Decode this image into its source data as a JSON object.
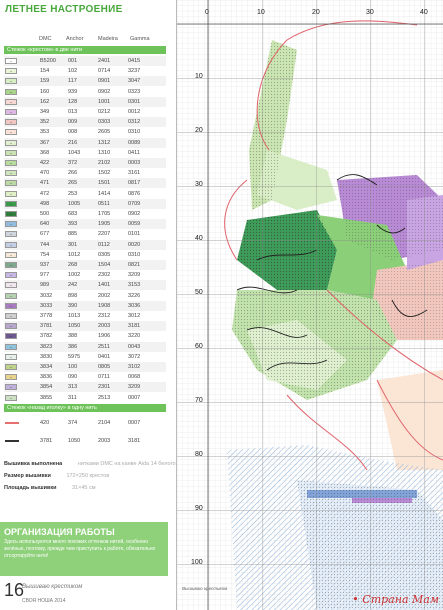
{
  "page": {
    "title": "ЛЕТНЕЕ НАСТРОЕНИЕ",
    "number": "16",
    "magazine": "Вышиваю крестиком",
    "issue": "СВОЯ НОША 2014"
  },
  "legend": {
    "columns": [
      "DMC",
      "Anchor",
      "Madeira",
      "Gamma"
    ],
    "section_cross": "Стежок «крестом» в две нити",
    "rows": [
      {
        "sym": "··",
        "c": "#ffffff",
        "v": [
          "B5200",
          "001",
          "2401",
          "0415"
        ]
      },
      {
        "sym": "··",
        "c": "#e9f4d8",
        "v": [
          "154",
          "102",
          "0714",
          "3237"
        ]
      },
      {
        "sym": "··",
        "c": "#d7eec3",
        "v": [
          "159",
          "117",
          "0901",
          "3047"
        ]
      },
      {
        "sym": "··",
        "c": "#a9d48a",
        "v": [
          "160",
          "939",
          "0902",
          "0323"
        ]
      },
      {
        "sym": "··",
        "c": "#f7d8d4",
        "v": [
          "162",
          "128",
          "1001",
          "0301"
        ]
      },
      {
        "sym": "··",
        "c": "#dfb8e6",
        "v": [
          "349",
          "013",
          "0212",
          "0012"
        ]
      },
      {
        "sym": "··",
        "c": "#f2c6c2",
        "v": [
          "352",
          "009",
          "0303",
          "0312"
        ]
      },
      {
        "sym": "··",
        "c": "#fbe2d8",
        "v": [
          "353",
          "008",
          "2605",
          "0310"
        ]
      },
      {
        "sym": "··",
        "c": "#e2efd1",
        "v": [
          "367",
          "216",
          "1312",
          "0089"
        ]
      },
      {
        "sym": "··",
        "c": "#c9e4b2",
        "v": [
          "368",
          "1043",
          "1310",
          "0411"
        ]
      },
      {
        "sym": "··",
        "c": "#b8dc9c",
        "v": [
          "422",
          "372",
          "2102",
          "0003"
        ]
      },
      {
        "sym": "··",
        "c": "#cfe5bb",
        "v": [
          "470",
          "266",
          "1502",
          "3161"
        ]
      },
      {
        "sym": "··",
        "c": "#bcdba4",
        "v": [
          "471",
          "265",
          "1501",
          "0817"
        ]
      },
      {
        "sym": "··",
        "c": "#e2f0c8",
        "v": [
          "472",
          "253",
          "1414",
          "0876"
        ]
      },
      {
        "sym": "··",
        "c": "#3a9c4a",
        "v": [
          "498",
          "1005",
          "0511",
          "0709"
        ]
      },
      {
        "sym": "··",
        "c": "#2f7e3c",
        "v": [
          "500",
          "683",
          "1705",
          "0902"
        ]
      },
      {
        "sym": "··",
        "c": "#93bde0",
        "v": [
          "640",
          "393",
          "1905",
          "0059"
        ]
      },
      {
        "sym": "··",
        "c": "#d0d4dc",
        "v": [
          "677",
          "885",
          "2207",
          "0101"
        ]
      },
      {
        "sym": "··",
        "c": "#c4cfe6",
        "v": [
          "744",
          "301",
          "0112",
          "0020"
        ]
      },
      {
        "sym": "··",
        "c": "#f5e8d6",
        "v": [
          "754",
          "1012",
          "0305",
          "0310"
        ]
      },
      {
        "sym": "··",
        "c": "#7fa98c",
        "v": [
          "937",
          "268",
          "1504",
          "0821"
        ]
      },
      {
        "sym": "··",
        "c": "#c9b8e6",
        "v": [
          "977",
          "1002",
          "2302",
          "3209"
        ]
      },
      {
        "sym": "··",
        "c": "#f2e6ee",
        "v": [
          "989",
          "242",
          "1401",
          "3153"
        ]
      },
      {
        "sym": "··",
        "c": "#b6d1b0",
        "v": [
          "3032",
          "898",
          "2002",
          "3226"
        ]
      },
      {
        "sym": "··",
        "c": "#a97cc2",
        "v": [
          "3033",
          "390",
          "1908",
          "3036"
        ]
      },
      {
        "sym": "··",
        "c": "#cfcfcf",
        "v": [
          "3778",
          "1013",
          "2312",
          "3012"
        ]
      },
      {
        "sym": "··",
        "c": "#b7a7cc",
        "v": [
          "3781",
          "1050",
          "2003",
          "3181"
        ]
      },
      {
        "sym": "··",
        "c": "#6e5790",
        "v": [
          "3782",
          "388",
          "1906",
          "3220"
        ]
      },
      {
        "sym": "··",
        "c": "#8ec5dc",
        "v": [
          "3823",
          "386",
          "2511",
          "0043"
        ]
      },
      {
        "sym": "··",
        "c": "#e6f0ea",
        "v": [
          "3830",
          "5975",
          "0401",
          "3072"
        ]
      },
      {
        "sym": "··",
        "c": "#c0d38a",
        "v": [
          "3834",
          "100",
          "0805",
          "3102"
        ]
      },
      {
        "sym": "··",
        "c": "#ead38c",
        "v": [
          "3836",
          "090",
          "0711",
          "0068"
        ]
      },
      {
        "sym": "··",
        "c": "#bfb0dc",
        "v": [
          "3854",
          "313",
          "2301",
          "3209"
        ]
      },
      {
        "sym": "··",
        "c": "#cde0c4",
        "v": [
          "3855",
          "311",
          "2513",
          "0007"
        ]
      }
    ],
    "section_back": "Стежок «назад иголку» в одну нить",
    "back_rows": [
      {
        "line": "#e66f6f",
        "v": [
          "420",
          "374",
          "2104",
          "0007"
        ]
      },
      {
        "line": "#333333",
        "v": [
          "3781",
          "1050",
          "2003",
          "3181"
        ]
      }
    ]
  },
  "info": {
    "done_label": "Вышивка выполнена",
    "done_value": "нитками DMC на канве Aida 14 белого цвета",
    "size_label": "Размер вышивки",
    "size_value": "172×250 крестов",
    "area_label": "Площадь вышивки",
    "area_value": "31×45 см"
  },
  "organization": {
    "title": "ОРГАНИЗАЦИЯ РАБОТЫ",
    "text": "Здесь используются много похожих оттенков нитей, особенно зелёных, поэтому, прежде чем приступить к работе, обязательно отсортируйте нити!"
  },
  "chart_axis": {
    "top": [
      "0",
      "10",
      "20",
      "30",
      "40"
    ],
    "left": [
      "10",
      "20",
      "30",
      "40",
      "50",
      "60",
      "70",
      "80",
      "90",
      "100"
    ]
  },
  "chart_logo": "Вышиваю крестиком",
  "watermark": "Страна Мам"
}
